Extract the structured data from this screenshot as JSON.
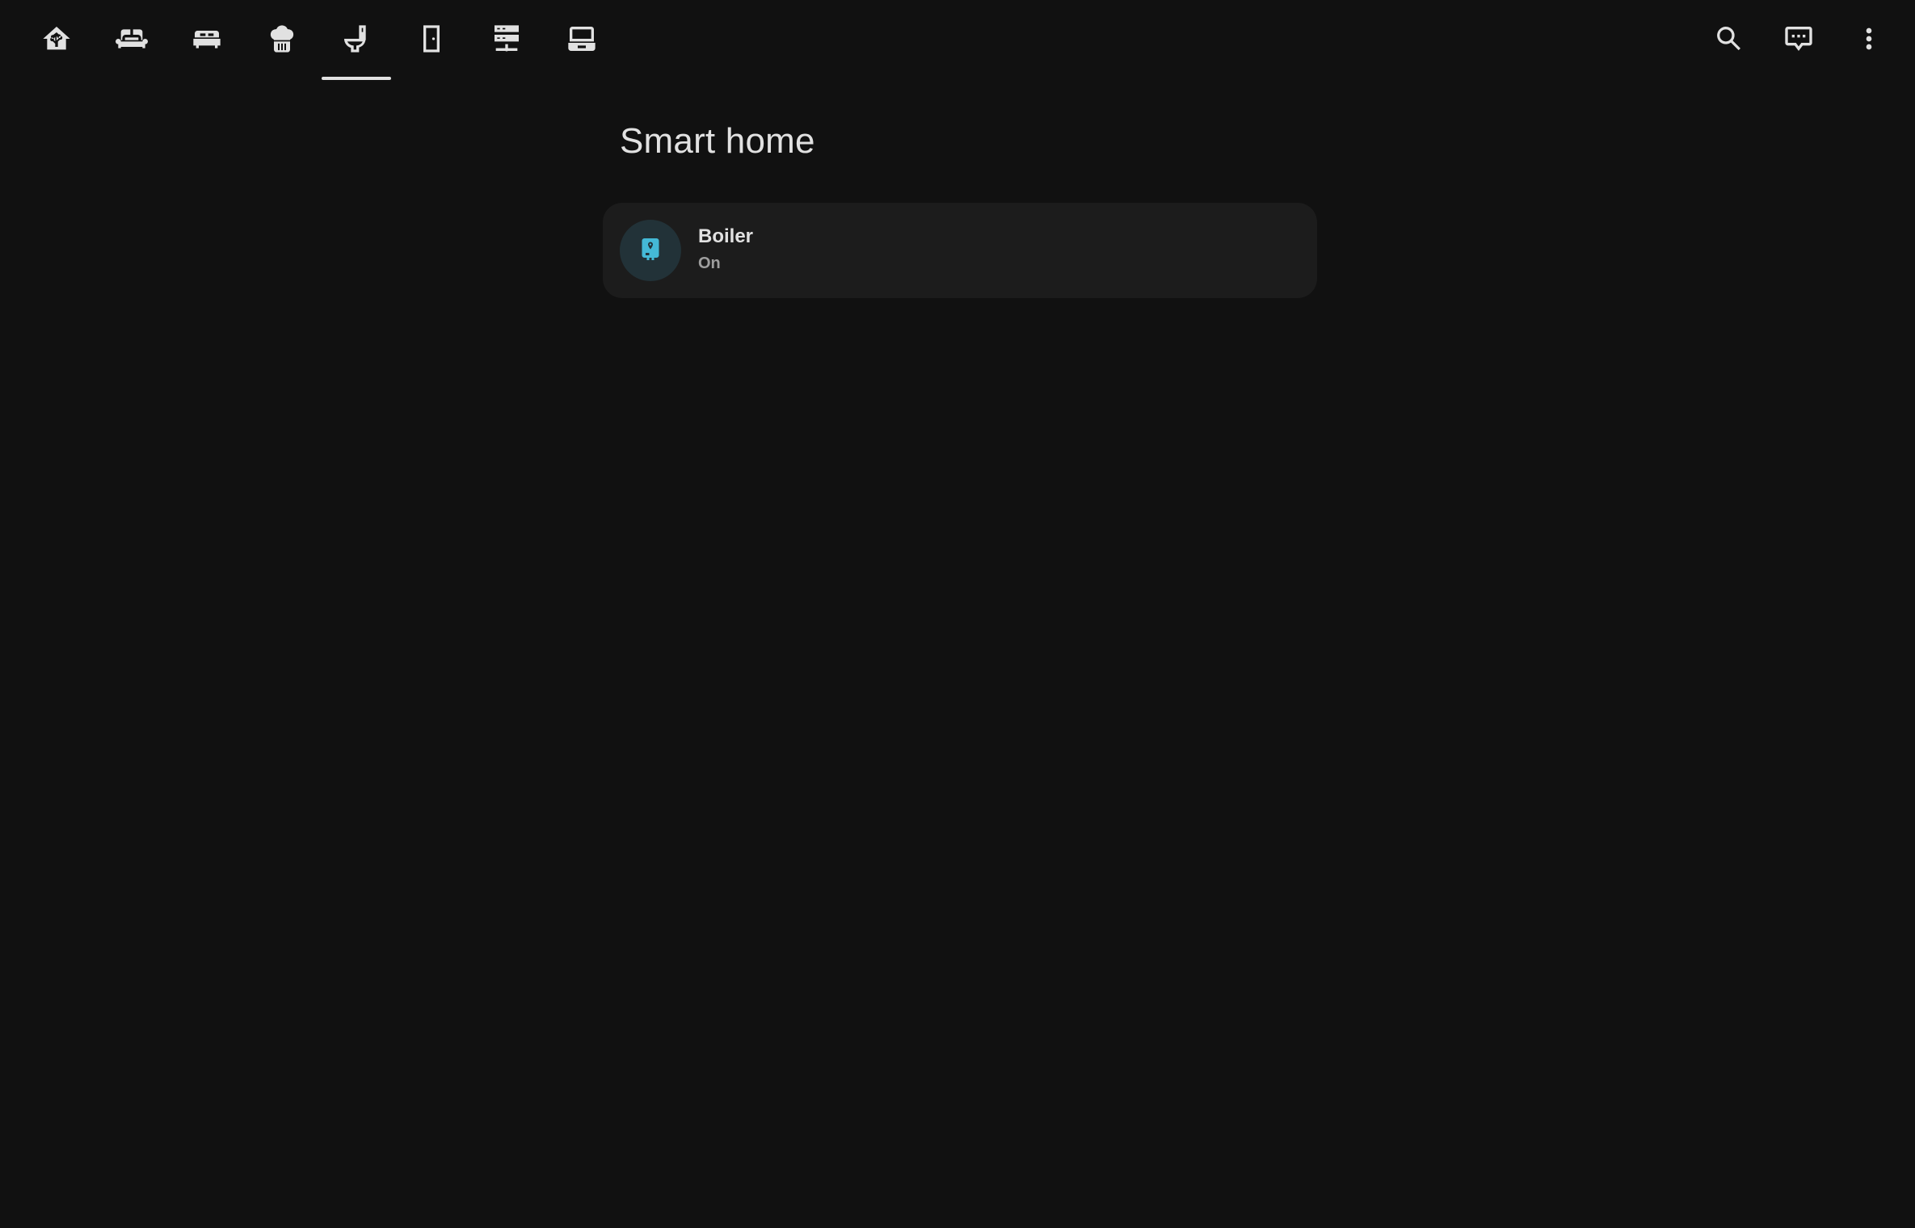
{
  "tabs": [
    {
      "icon": "home-assistant-icon",
      "label": "Home"
    },
    {
      "icon": "sofa-icon",
      "label": "Living room"
    },
    {
      "icon": "bed-icon",
      "label": "Bedroom"
    },
    {
      "icon": "chef-hat-icon",
      "label": "Kitchen"
    },
    {
      "icon": "toilet-icon",
      "label": "Bathroom",
      "selected": true
    },
    {
      "icon": "door-icon",
      "label": "Hallway"
    },
    {
      "icon": "server-network-icon",
      "label": "Network"
    },
    {
      "icon": "laptop-icon",
      "label": "Office"
    }
  ],
  "actions": [
    {
      "icon": "search-icon",
      "label": "Search"
    },
    {
      "icon": "assist-icon",
      "label": "Assist"
    },
    {
      "icon": "dots-vertical-icon",
      "label": "More options"
    }
  ],
  "main": {
    "title": "Smart home",
    "tiles": [
      {
        "icon": "water-boiler-icon",
        "name": "Boiler",
        "state": "On",
        "accent": "#44b9d6"
      }
    ]
  },
  "colors": {
    "background": "#111111",
    "card": "#1c1c1c",
    "icon_fg": "#e1e1e1",
    "accent": "#44b9d6"
  }
}
